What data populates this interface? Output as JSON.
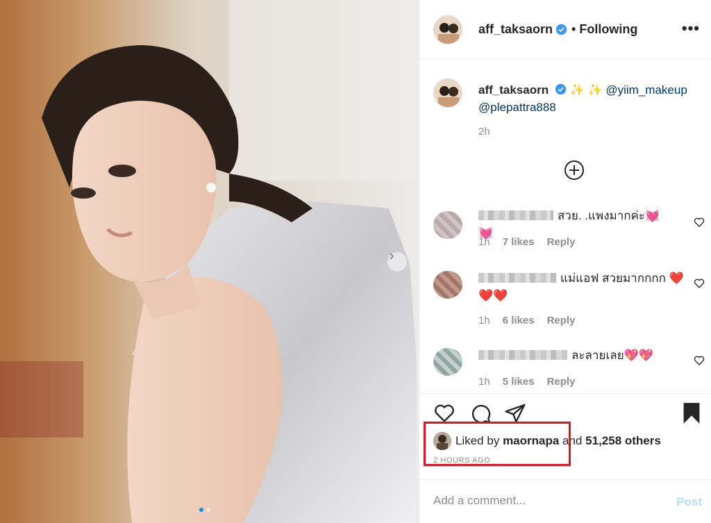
{
  "post": {
    "username": "aff_taksaorn",
    "follow_status": "Following",
    "more_label": "•••",
    "caption": {
      "username": "aff_taksaorn",
      "sparkles": "✨ ✨",
      "mention_1": "@yiim_makeup",
      "mention_2": "@plepattra888",
      "time": "2h"
    },
    "comments": [
      {
        "text": "สวย. .แพงมากค่ะ💓💓",
        "time": "1h",
        "likes": "7 likes",
        "reply": "Reply"
      },
      {
        "text": "แม่แอฟ สวยมากกกก ❤️❤️❤️",
        "time": "1h",
        "likes": "6 likes",
        "reply": "Reply"
      },
      {
        "text": "ละลายเลย💖💖",
        "time": "1h",
        "likes": "5 likes",
        "reply": "Reply"
      }
    ],
    "likes": {
      "prefix": "Liked by",
      "liker": "maornapa",
      "connector": "and",
      "others": "51,258 others"
    },
    "timestamp": "2 HOURS AGO",
    "add_comment_placeholder": "Add a comment...",
    "post_button": "Post"
  },
  "colors": {
    "highlight": "#e0141e",
    "verified": "#3897f0",
    "mention": "#00376b",
    "post_disabled": "#b2dffc"
  }
}
